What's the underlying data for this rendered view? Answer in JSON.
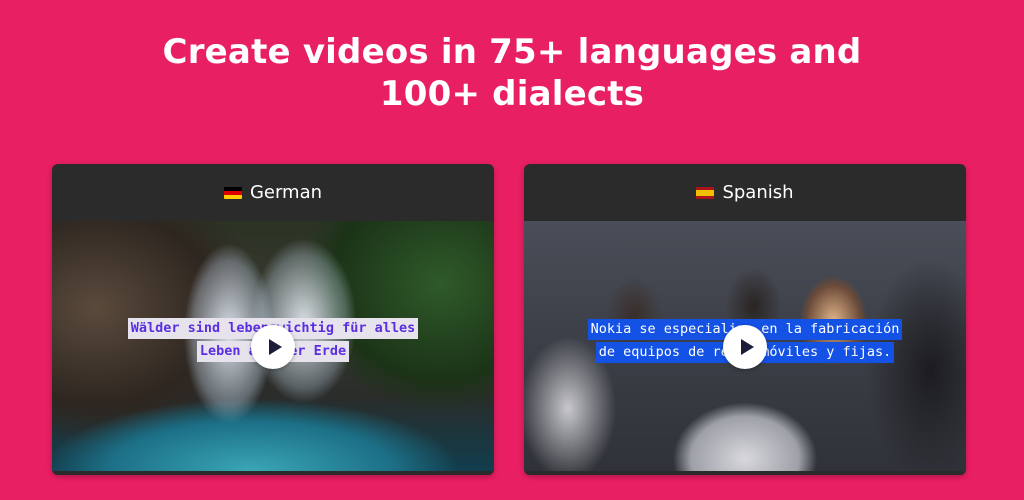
{
  "headline": {
    "line1": "Create videos in 75+ languages and",
    "line2": "100+ dialects"
  },
  "cards": [
    {
      "language": "German",
      "flag_icon": "germany-flag-icon",
      "subtitle_lines": [
        "Wälder sind lebenswichtig für alles",
        "Leben auf der Erde"
      ]
    },
    {
      "language": "Spanish",
      "flag_icon": "spain-flag-icon",
      "subtitle_lines": [
        "Nokia se especializa en la fabricación",
        "de equipos de redes móviles y fijas."
      ]
    }
  ],
  "colors": {
    "background": "#e91f63",
    "card": "#2b2b2b",
    "german_subtitle_text": "#5b2ee0",
    "spanish_subtitle_bg": "#1452e6"
  }
}
